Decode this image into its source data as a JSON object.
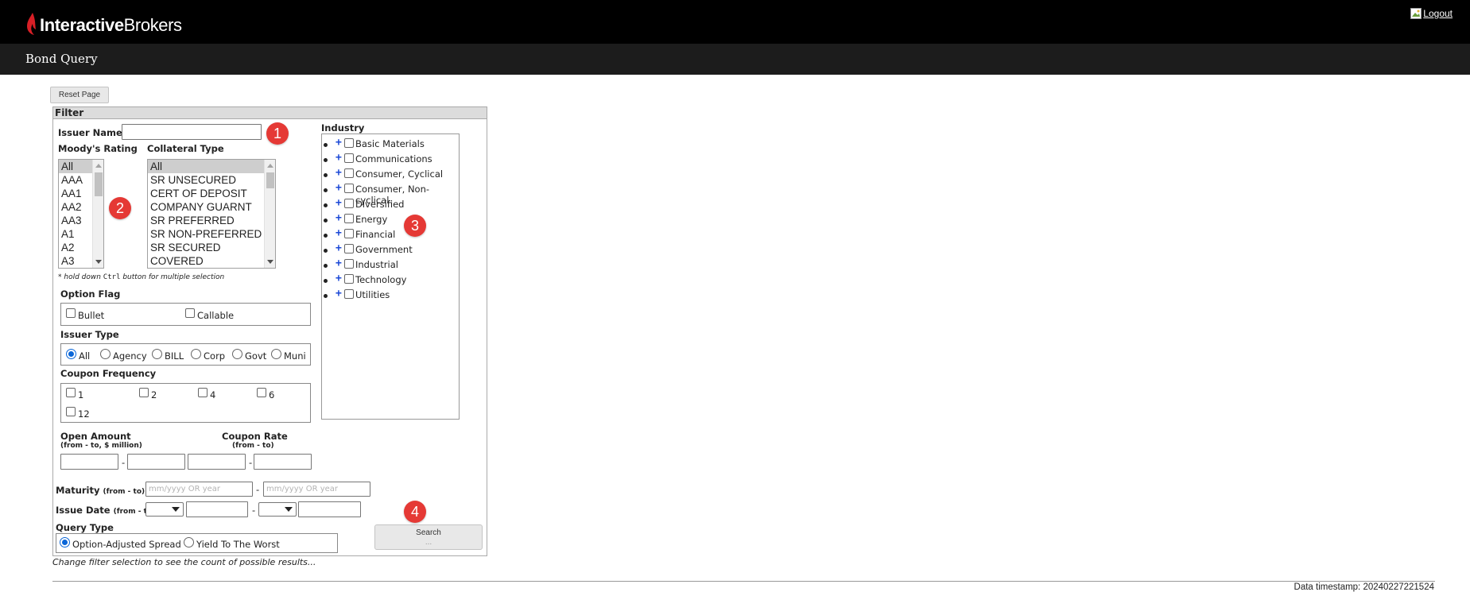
{
  "header": {
    "brand_prefix": "Interactive",
    "brand_suffix": "Brokers",
    "logout_label": "Logout",
    "page_title": "Bond Query"
  },
  "toolbar": {
    "reset_label": "Reset Page"
  },
  "filter": {
    "title": "Filter",
    "issuer_name": {
      "label": "Issuer Name",
      "value": ""
    },
    "moodys": {
      "label": "Moody's Rating",
      "options": [
        "All",
        "AAA",
        "AA1",
        "AA2",
        "AA3",
        "A1",
        "A2",
        "A3"
      ],
      "selected": "All"
    },
    "collateral": {
      "label": "Collateral Type",
      "options": [
        "All",
        "SR UNSECURED",
        "CERT OF DEPOSIT",
        "COMPANY GUARNT",
        "SR PREFERRED",
        "SR NON-PREFERRED",
        "SR SECURED",
        "COVERED"
      ],
      "selected": "All"
    },
    "multi_hint_prefix": "* hold down ",
    "multi_hint_key": "Ctrl",
    "multi_hint_suffix": " button for multiple selection",
    "option_flag": {
      "label": "Option Flag",
      "options": [
        "Bullet",
        "Callable"
      ]
    },
    "issuer_type": {
      "label": "Issuer Type",
      "options": [
        "All",
        "Agency",
        "BILL",
        "Corp",
        "Govt",
        "Muni"
      ],
      "selected": "All"
    },
    "coupon_frequency": {
      "label": "Coupon Frequency",
      "options": [
        "1",
        "2",
        "4",
        "6",
        "12"
      ]
    },
    "open_amount": {
      "label": "Open Amount",
      "sub": "(from - to, $ million)"
    },
    "coupon_rate": {
      "label": "Coupon Rate",
      "sub": "(from - to)"
    },
    "range_sep": "-",
    "maturity": {
      "label": "Maturity",
      "range": "(from - to)",
      "placeholder": "mm/yyyy OR year"
    },
    "issue_date": {
      "label": "Issue Date",
      "range": "(from - to)"
    },
    "query_type": {
      "label": "Query Type",
      "options": [
        "Option-Adjusted Spread",
        "Yield To The Worst"
      ],
      "selected": "Option-Adjusted Spread"
    },
    "search_label": "Search",
    "search_sub": "..."
  },
  "industry": {
    "label": "Industry",
    "items": [
      "Basic Materials",
      "Communications",
      "Consumer, Cyclical",
      "Consumer, Non-cyclical",
      "Diversified",
      "Energy",
      "Financial",
      "Government",
      "Industrial",
      "Technology",
      "Utilities"
    ]
  },
  "markers": [
    "1",
    "2",
    "3",
    "4"
  ],
  "status_text": "Change filter selection to see the count of possible results...",
  "timestamp": "Data timestamp: 20240227221524",
  "colors": {
    "brand_red": "#d81f26",
    "marker_red": "#e53935",
    "radio_blue": "#0a66d8",
    "plus_blue": "#1a47d6"
  }
}
